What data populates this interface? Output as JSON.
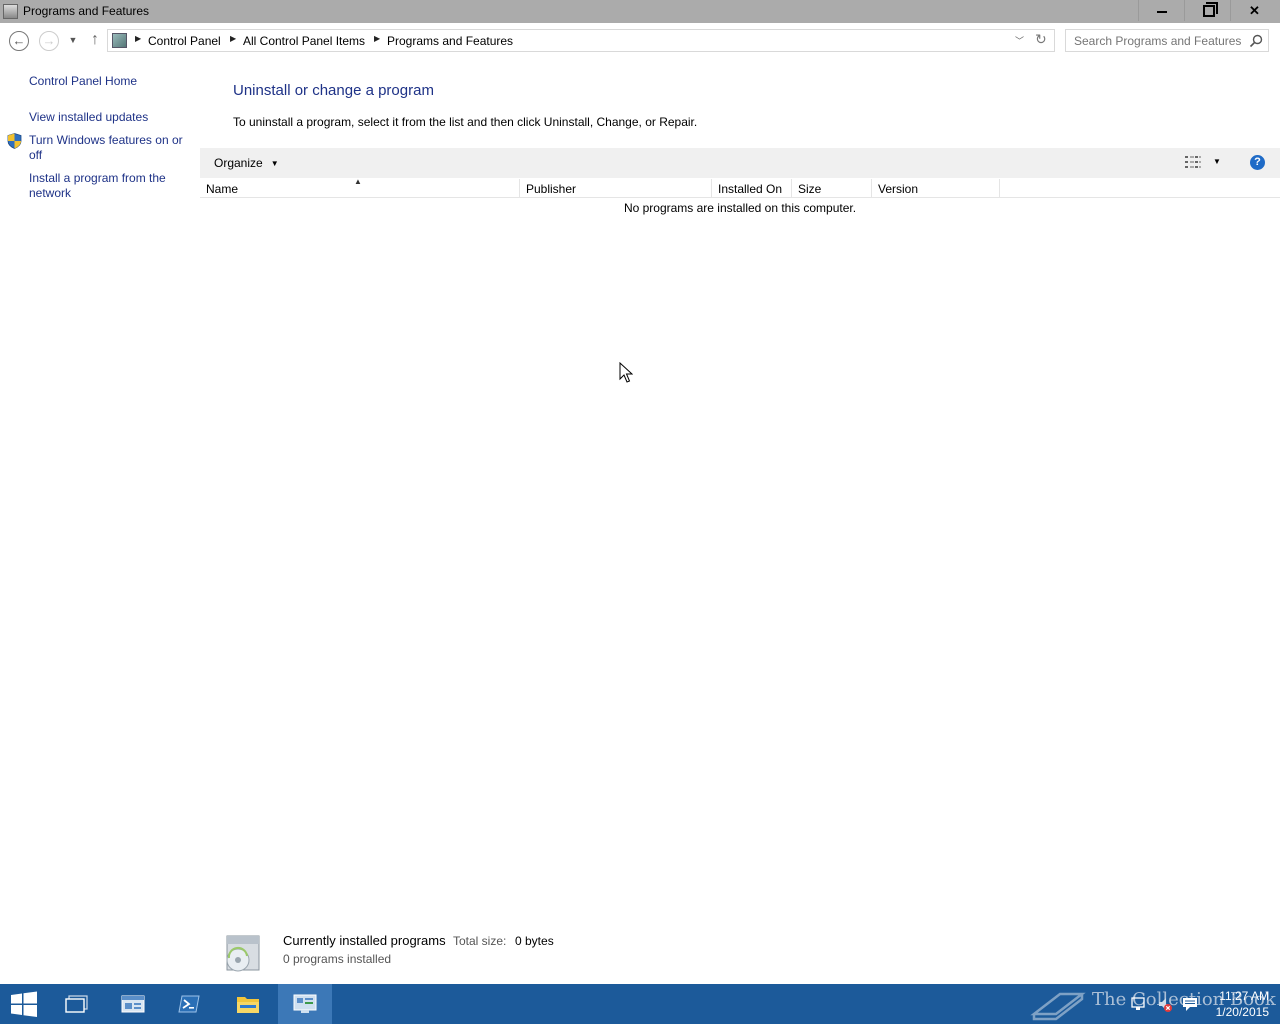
{
  "window": {
    "title": "Programs and Features"
  },
  "navigation": {
    "breadcrumbs": [
      "Control Panel",
      "All Control Panel Items",
      "Programs and Features"
    ],
    "search_placeholder": "Search Programs and Features"
  },
  "sidebar": {
    "links": [
      {
        "label": "Control Panel Home"
      },
      {
        "label": "View installed updates"
      },
      {
        "label": "Turn Windows features on or off"
      },
      {
        "label": "Install a program from the network"
      }
    ]
  },
  "main": {
    "heading": "Uninstall or change a program",
    "description": "To uninstall a program, select it from the list and then click Uninstall, Change, or Repair.",
    "toolbar": {
      "organize_label": "Organize"
    },
    "columns": [
      "Name",
      "Publisher",
      "Installed On",
      "Size",
      "Version"
    ],
    "empty_message": "No programs are installed on this computer."
  },
  "details": {
    "title": "Currently installed programs",
    "total_size_label": "Total size:",
    "total_size_value": "0 bytes",
    "count": "0 programs installed"
  },
  "taskbar": {
    "time": "11:27 AM",
    "date": "1/20/2015",
    "watermark": "The Collection Book"
  },
  "colors": {
    "link": "#1e3287",
    "taskbar": "#1c5a9a",
    "titlebar": "#ababab"
  }
}
